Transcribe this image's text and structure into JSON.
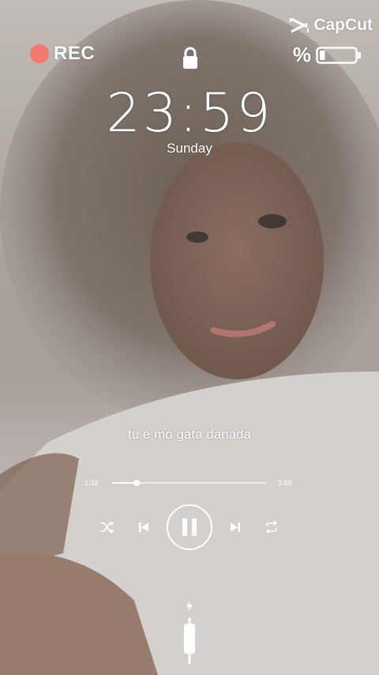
{
  "status": {
    "rec_label": "REC",
    "brand": "CapCut",
    "battery_percent_symbol": "%",
    "battery_level": 0.15
  },
  "lock": {
    "icon": "lock-icon",
    "time": "23:59",
    "day": "Sunday"
  },
  "player": {
    "lyric": "tu é mó gata danada",
    "elapsed": "1:32",
    "total": "3:60",
    "progress": 0.16,
    "controls": {
      "shuffle_icon": "shuffle-icon",
      "previous_icon": "previous-icon",
      "pause_icon": "pause-icon",
      "next_icon": "next-icon",
      "repeat_icon": "repeat-icon"
    }
  },
  "charging": {
    "icon": "charging-cable-icon"
  },
  "colors": {
    "rec_dot": "#f2796b",
    "text": "#ffffff"
  }
}
